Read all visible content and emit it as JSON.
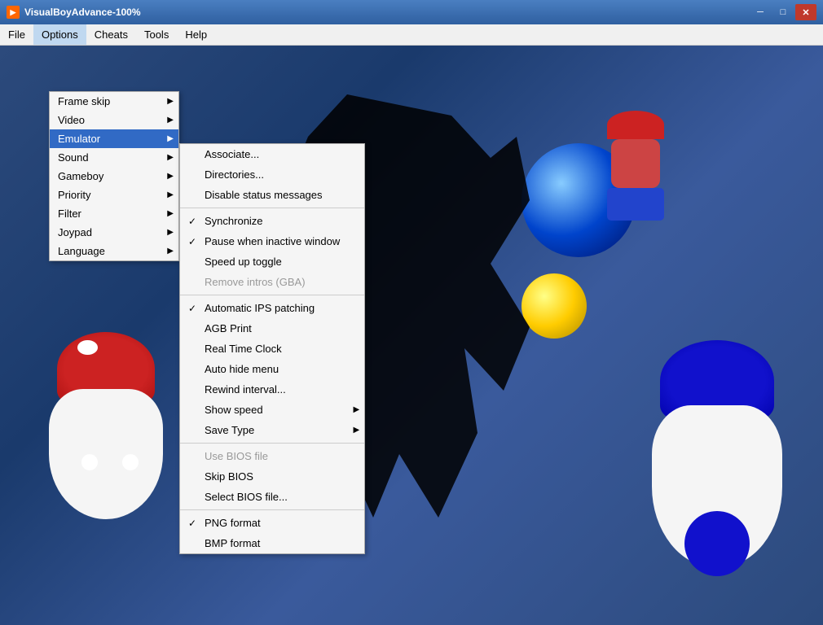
{
  "titlebar": {
    "icon": "GBA",
    "title": "VisualBoyAdvance-100%",
    "minimize": "─",
    "maximize": "□",
    "close": "✕"
  },
  "menubar": {
    "items": [
      {
        "id": "file",
        "label": "File"
      },
      {
        "id": "options",
        "label": "Options"
      },
      {
        "id": "cheats",
        "label": "Cheats"
      },
      {
        "id": "tools",
        "label": "Tools"
      },
      {
        "id": "help",
        "label": "Help"
      }
    ]
  },
  "options_menu": {
    "items": [
      {
        "id": "frame-skip",
        "label": "Frame skip",
        "has_submenu": true,
        "checked": false,
        "disabled": false
      },
      {
        "id": "video",
        "label": "Video",
        "has_submenu": true,
        "checked": false,
        "disabled": false
      },
      {
        "id": "emulator",
        "label": "Emulator",
        "has_submenu": true,
        "checked": false,
        "disabled": false,
        "active": true
      },
      {
        "id": "sound",
        "label": "Sound",
        "has_submenu": true,
        "checked": false,
        "disabled": false
      },
      {
        "id": "gameboy",
        "label": "Gameboy",
        "has_submenu": true,
        "checked": false,
        "disabled": false
      },
      {
        "id": "priority",
        "label": "Priority",
        "has_submenu": true,
        "checked": false,
        "disabled": false
      },
      {
        "id": "filter",
        "label": "Filter",
        "has_submenu": true,
        "checked": false,
        "disabled": false
      },
      {
        "id": "joypad",
        "label": "Joypad",
        "has_submenu": true,
        "checked": false,
        "disabled": false
      },
      {
        "id": "language",
        "label": "Language",
        "has_submenu": true,
        "checked": false,
        "disabled": false
      }
    ]
  },
  "emulator_menu": {
    "items": [
      {
        "id": "associate",
        "label": "Associate...",
        "has_submenu": false,
        "checked": false,
        "disabled": false
      },
      {
        "id": "directories",
        "label": "Directories...",
        "has_submenu": false,
        "checked": false,
        "disabled": false
      },
      {
        "id": "disable-status",
        "label": "Disable status messages",
        "has_submenu": false,
        "checked": false,
        "disabled": false
      },
      {
        "separator": true
      },
      {
        "id": "synchronize",
        "label": "Synchronize",
        "has_submenu": false,
        "checked": true,
        "disabled": false
      },
      {
        "id": "pause-inactive",
        "label": "Pause when inactive window",
        "has_submenu": false,
        "checked": true,
        "disabled": false
      },
      {
        "id": "speed-toggle",
        "label": "Speed up toggle",
        "has_submenu": false,
        "checked": false,
        "disabled": false
      },
      {
        "id": "remove-intros",
        "label": "Remove intros (GBA)",
        "has_submenu": false,
        "checked": false,
        "disabled": true
      },
      {
        "separator2": true
      },
      {
        "id": "auto-ips",
        "label": "Automatic IPS patching",
        "has_submenu": false,
        "checked": true,
        "disabled": false
      },
      {
        "id": "agb-print",
        "label": "AGB Print",
        "has_submenu": false,
        "checked": false,
        "disabled": false
      },
      {
        "id": "real-time-clock",
        "label": "Real Time Clock",
        "has_submenu": false,
        "checked": false,
        "disabled": false
      },
      {
        "id": "auto-hide-menu",
        "label": "Auto hide menu",
        "has_submenu": false,
        "checked": false,
        "disabled": false
      },
      {
        "id": "rewind-interval",
        "label": "Rewind interval...",
        "has_submenu": false,
        "checked": false,
        "disabled": false
      },
      {
        "id": "show-speed",
        "label": "Show speed",
        "has_submenu": true,
        "checked": false,
        "disabled": false
      },
      {
        "id": "save-type",
        "label": "Save Type",
        "has_submenu": true,
        "checked": false,
        "disabled": false
      },
      {
        "separator3": true
      },
      {
        "id": "use-bios",
        "label": "Use BIOS file",
        "has_submenu": false,
        "checked": false,
        "disabled": true
      },
      {
        "id": "skip-bios",
        "label": "Skip BIOS",
        "has_submenu": false,
        "checked": false,
        "disabled": false
      },
      {
        "id": "select-bios",
        "label": "Select BIOS file...",
        "has_submenu": false,
        "checked": false,
        "disabled": false
      },
      {
        "separator4": true
      },
      {
        "id": "png-format",
        "label": "PNG format",
        "has_submenu": false,
        "checked": true,
        "disabled": false
      },
      {
        "id": "bmp-format",
        "label": "BMP format",
        "has_submenu": false,
        "checked": false,
        "disabled": false
      }
    ]
  }
}
